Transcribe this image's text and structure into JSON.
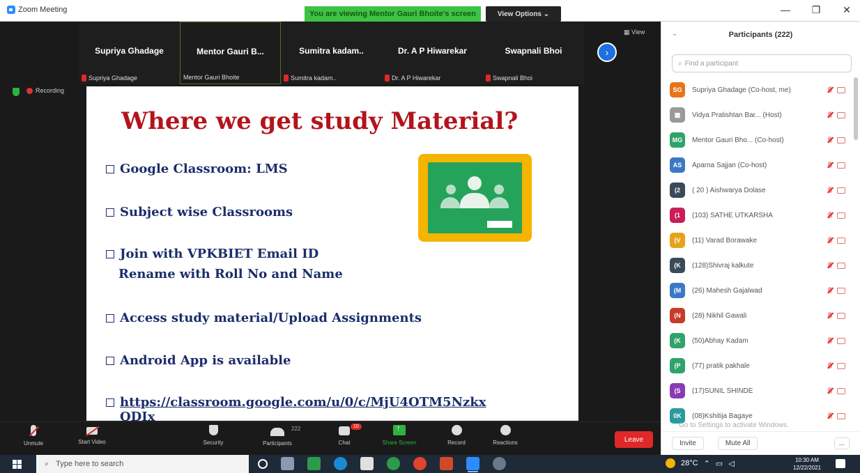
{
  "window": {
    "title": "Zoom Meeting",
    "share_banner": "You are viewing Mentor Gauri Bhoite's screen",
    "view_options": "View Options ⌄",
    "controls": [
      "—",
      "❐",
      "✕"
    ]
  },
  "strip": {
    "tiles": [
      {
        "big": "Supriya Ghadage",
        "small": "Supriya Ghadage"
      },
      {
        "big": "Mentor Gauri B...",
        "small": "Mentor Gauri Bhoite"
      },
      {
        "big": "Sumitra kadam..",
        "small": "Sumitra kadam.."
      },
      {
        "big": "Dr. A P Hiwarekar",
        "small": "Dr. A P Hiwarekar"
      },
      {
        "big": "Swapnali Bhoi",
        "small": "Swapnali Bhoi"
      }
    ],
    "view_label": "▦ View",
    "next_arrow": "›"
  },
  "status": {
    "recording": "Recording"
  },
  "slide": {
    "title": "Where we get study Material?",
    "bullets": [
      "Google Classroom: LMS",
      "Subject wise Classrooms",
      "Join with VPKBIET Email ID",
      "Access study material/Upload Assignments",
      "Android App is available"
    ],
    "bullet3_sub": "Rename with Roll No and Name",
    "link_line1": "https://classroom.google.com/u/0/c/MjU4OTM5Nzkx",
    "link_line2": "ODIx"
  },
  "toolbar": {
    "unmute": "Unmute",
    "start_video": "Start Video",
    "security": "Security",
    "participants": "Participants",
    "participants_count": "222",
    "chat": "Chat",
    "chat_badge": "10",
    "share_screen": "Share Screen",
    "record": "Record",
    "reactions": "Reactions",
    "leave": "Leave"
  },
  "panel": {
    "title": "Participants (222)",
    "search_placeholder": "Find a participant",
    "participants": [
      {
        "initials": "SG",
        "name": "Supriya Ghadage (Co-host, me)",
        "color": "#e8741a"
      },
      {
        "initials": "▦",
        "name": "Vidya Pratishtan Bar... (Host)",
        "color": "#9a9a9a"
      },
      {
        "initials": "MG",
        "name": "Mentor Gauri Bho... (Co-host)",
        "color": "#2fa36a"
      },
      {
        "initials": "AS",
        "name": "Aparna Sajjan (Co-host)",
        "color": "#3d78c7"
      },
      {
        "initials": "(2",
        "name": "( 20 ) Aishwarya Dolase",
        "color": "#3a4a5a"
      },
      {
        "initials": "(1",
        "name": "(103) SATHE UTKARSHA",
        "color": "#c81e5a"
      },
      {
        "initials": "(V",
        "name": "(11) Varad Borawake",
        "color": "#e8a21a"
      },
      {
        "initials": "(K",
        "name": "(128)Shivraj kalkute",
        "color": "#3a4a5a"
      },
      {
        "initials": "(M",
        "name": "(26) Mahesh Gajalwad",
        "color": "#3d78c7"
      },
      {
        "initials": "(N",
        "name": "(28) Nikhil Gawali",
        "color": "#c83a2a"
      },
      {
        "initials": "(K",
        "name": "(50)Abhay Kadam",
        "color": "#2fa36a"
      },
      {
        "initials": "(P",
        "name": "(77) pratik pakhale",
        "color": "#2fa36a"
      },
      {
        "initials": "(S",
        "name": "(17)SUNIL SHINDE",
        "color": "#8a3ab5"
      },
      {
        "initials": "0K",
        "name": "(08)Kshitija Bagaye",
        "color": "#2a9a9a"
      }
    ],
    "activate_text": "Go to Settings to activate Windows.",
    "invite": "Invite",
    "mute_all": "Mute All",
    "more": "..."
  },
  "taskbar": {
    "search_placeholder": "Type here to search",
    "weather": "28°C",
    "time": "10:30 AM",
    "date": "12/22/2021"
  }
}
